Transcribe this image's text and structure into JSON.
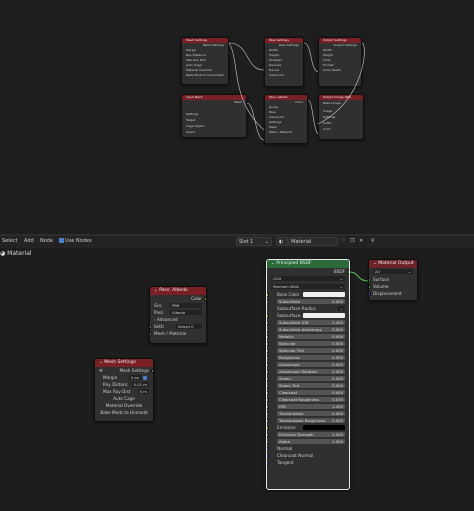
{
  "top_nodes": {
    "mesh_settings": {
      "title": "Mesh Settings",
      "out": "Mesh Settings",
      "rows": [
        "Margin",
        "Ray Distance",
        "Max Ray Dist",
        "Auto Cage",
        "Material Override",
        "Bake Mods to Unmodded"
      ],
      "vals": [
        "4 px",
        "0.01 m",
        "0 m",
        "",
        "",
        ""
      ]
    },
    "pass_settings": {
      "title": "Pass Settings",
      "out": "Pass Settings",
      "rows": [
        "Width",
        "Height",
        "Samples",
        "Denoise",
        "Device",
        "Advanced"
      ],
      "vals": [
        "1024 px",
        "1024 px",
        "1",
        "",
        "CPU",
        ""
      ]
    },
    "output_settings": {
      "title": "Output Settings",
      "out": "Output Settings",
      "rows": [
        "Width",
        "Height",
        "Clear",
        "Format",
        "Color Depth"
      ],
      "vals": [
        "1024 px",
        "1024 px",
        "",
        "PNG",
        "8"
      ]
    },
    "input_mesh": {
      "title": "Input Mesh",
      "out": "Mesh",
      "rows": [
        "Settings",
        "Target",
        "Cage Object",
        "Scene"
      ]
    },
    "pass_albedo": {
      "title": "Pass: Albedo",
      "out": "Color",
      "rows": [
        "Group",
        "Pass",
        "Advanced",
        "Settings",
        "Mesh",
        "Mesh / Material"
      ],
      "vals": [
        "PBR",
        "Albedo"
      ]
    },
    "output_image": {
      "title": "Output Image Path",
      "rows": [
        "Bake Image",
        "Image",
        "Settings",
        "Suffix",
        "Color"
      ]
    }
  },
  "header": {
    "menu": [
      "Select",
      "Add",
      "Node"
    ],
    "use_nodes": "Use Nodes",
    "slot": "Slot 1",
    "material": "Material"
  },
  "breadcrumb": "Material",
  "pass_albedo": {
    "title": "Pass: Albedo",
    "out": "Color",
    "group_label": "Gro",
    "group_val": "PBR",
    "pass_label": "Pass",
    "pass_val": "Albedo",
    "advanced": "Advanced",
    "settings": "Setti",
    "samples_label": "Sampl",
    "samples_val": "0",
    "mesh": "Mesh / Material"
  },
  "mesh_settings": {
    "title": "Mesh Settings",
    "out": "Mesh Settings",
    "margin_label": "Margin",
    "margin_val": "0 px",
    "ray_label": "Ray Distanc",
    "ray_val": "0.01 m",
    "maxray_label": "Max Ray Dist",
    "maxray_val": "0 m",
    "auto_cage": "Auto Cage",
    "mat_override": "Material Override",
    "bake_mods": "Bake Mods to Unmodd"
  },
  "bsdf": {
    "title": "Principled BSDF",
    "out": "BSDF",
    "dist": "GGX",
    "sss_method": "Random Walk",
    "rows": [
      {
        "label": "Base Color",
        "type": "color"
      },
      {
        "label": "Subsurface",
        "val": "0.000"
      },
      {
        "label": "Subsurface Radius",
        "type": "dropdown"
      },
      {
        "label": "Subsurface ...",
        "type": "color"
      },
      {
        "label": "Subsurface IOR",
        "val": "1.400"
      },
      {
        "label": "Subsurface Anisotropy",
        "val": "0.000"
      },
      {
        "label": "Metallic",
        "val": "0.000"
      },
      {
        "label": "Specular",
        "val": "0.500"
      },
      {
        "label": "Specular Tint",
        "val": "0.000"
      },
      {
        "label": "Roughness",
        "val": "0.500"
      },
      {
        "label": "Anisotropic",
        "val": "0.000"
      },
      {
        "label": "Anisotropic Rotation",
        "val": "0.000"
      },
      {
        "label": "Sheen",
        "val": "0.000"
      },
      {
        "label": "Sheen Tint",
        "val": "0.500"
      },
      {
        "label": "Clearcoat",
        "val": "0.000"
      },
      {
        "label": "Clearcoat Roughness",
        "val": "0.030"
      },
      {
        "label": "IOR",
        "val": "1.450"
      },
      {
        "label": "Transmission",
        "val": "0.000"
      },
      {
        "label": "Transmission Roughness",
        "val": "0.000"
      },
      {
        "label": "Emission",
        "type": "black"
      },
      {
        "label": "Emission Strength",
        "val": "1.000"
      },
      {
        "label": "Alpha",
        "val": "1.000"
      },
      {
        "label": "Normal",
        "type": "plain"
      },
      {
        "label": "Clearcoat Normal",
        "type": "plain"
      },
      {
        "label": "Tangent",
        "type": "plain"
      }
    ]
  },
  "mat_output": {
    "title": "Material Output",
    "target": "All",
    "inputs": [
      "Surface",
      "Volume",
      "Displacement"
    ]
  },
  "colors": {
    "bsdf_header": "#2b6b3a",
    "output_header": "#6d2129",
    "accent": "#4a7fd0"
  }
}
